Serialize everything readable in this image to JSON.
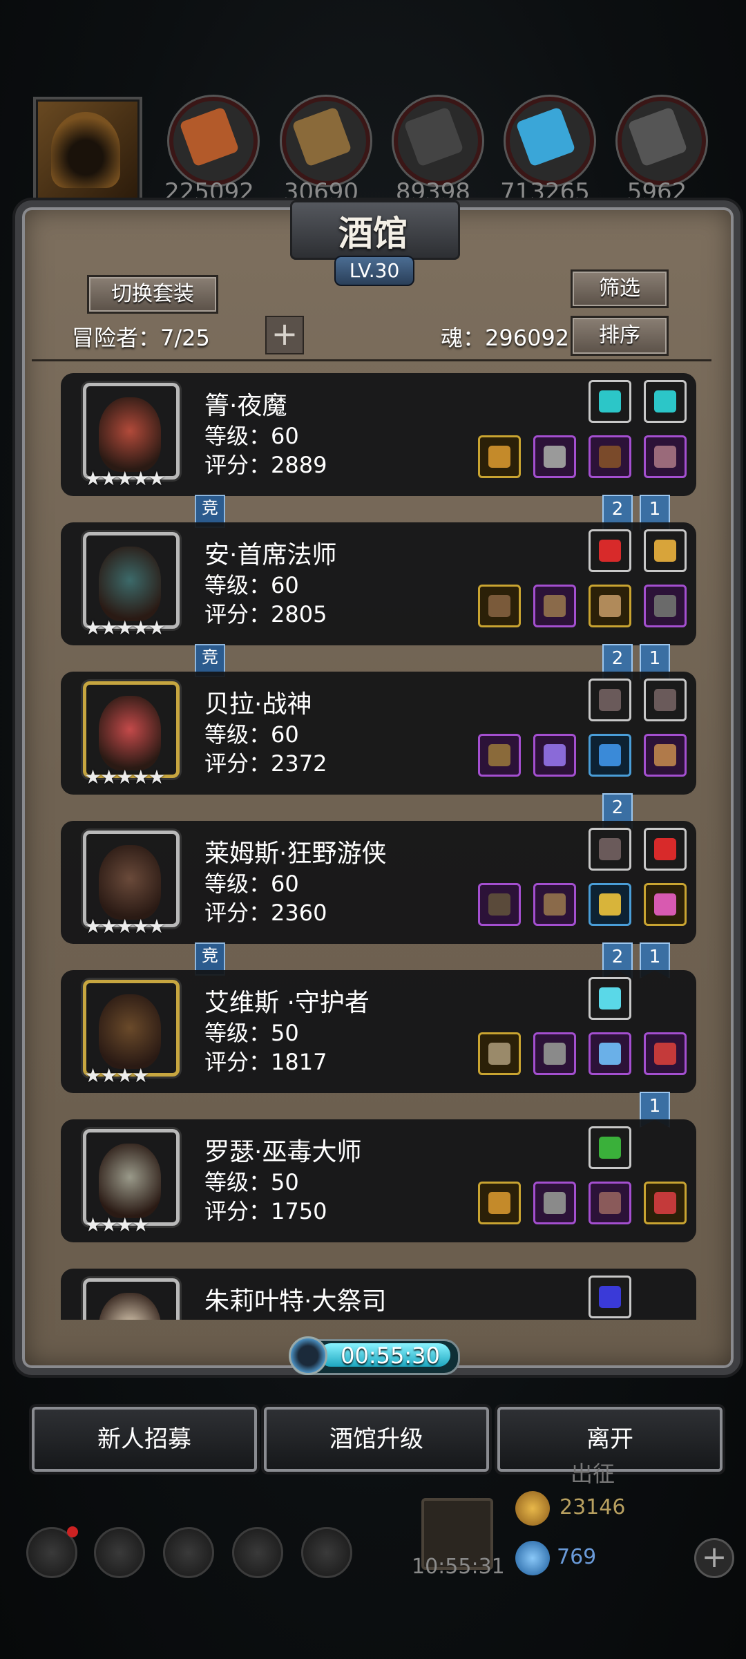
{
  "resources": {
    "values": [
      "225092",
      "30690",
      "89398",
      "713265",
      "5962"
    ],
    "colors": [
      "#b35a2a",
      "#8a6a3a",
      "#444444",
      "#3aa6d8",
      "#555555"
    ]
  },
  "panel": {
    "title": "酒馆",
    "level": "LV.30",
    "switch_set": "切换套装",
    "filter": "筛选",
    "sort": "排序",
    "adventurers": "冒险者：7/25",
    "add": "+",
    "soul": "魂：296092"
  },
  "heroes": [
    {
      "name": "箐·夜魔",
      "level": "等级：60",
      "score": "评分：2889",
      "stars": "★★★★★",
      "frame": "white",
      "face": "#b24a3a",
      "top": [
        "#2cc6c8",
        "#2cc6c8"
      ],
      "topc": [
        "w",
        "w"
      ],
      "bottom": [
        "#c48a2a",
        "#9a9a9a",
        "#7a4a2a",
        "#9a6a7a"
      ],
      "botc": [
        "y",
        "p",
        "p",
        "p"
      ],
      "ribbons": [
        "2",
        "1"
      ],
      "jing": "竞"
    },
    {
      "name": "安·首席法师",
      "level": "等级：60",
      "score": "评分：2805",
      "stars": "★★★★★",
      "frame": "white",
      "face": "#3c6a6a",
      "top": [
        "#d82a2a",
        "#d8a43a"
      ],
      "topc": [
        "w",
        "w"
      ],
      "bottom": [
        "#7a5a3a",
        "#8a6a4a",
        "#b08a5a",
        "#6a6a6a"
      ],
      "botc": [
        "y",
        "p",
        "y",
        "p"
      ],
      "ribbons": [
        "2",
        "1"
      ],
      "jing": "竞"
    },
    {
      "name": "贝拉·战神",
      "level": "等级：60",
      "score": "评分：2372",
      "stars": "★★★★★",
      "frame": "gold",
      "face": "#c44a4a",
      "top": [
        "#6a5a5a",
        "#6a5a5a"
      ],
      "topc": [
        "w",
        "w"
      ],
      "bottom": [
        "#8a6a3a",
        "#8a6ad8",
        "#3a8ad8",
        "#b07a4a"
      ],
      "botc": [
        "p",
        "p",
        "b",
        "p"
      ],
      "ribbons": [
        "2"
      ],
      "jing": ""
    },
    {
      "name": "莱姆斯·狂野游侠",
      "level": "等级：60",
      "score": "评分：2360",
      "stars": "★★★★★",
      "frame": "white",
      "face": "#6a4a3a",
      "top": [
        "#6a5a5a",
        "#d82a2a"
      ],
      "topc": [
        "w",
        "w"
      ],
      "bottom": [
        "#5a4a3a",
        "#8a6a4a",
        "#d8b43a",
        "#d85ab0"
      ],
      "botc": [
        "p",
        "p",
        "b",
        "y"
      ],
      "ribbons": [
        "2",
        "1"
      ],
      "jing": "竞"
    },
    {
      "name": "艾维斯 ·守护者",
      "level": "等级：50",
      "score": "评分：1817",
      "stars": "★★★★",
      "frame": "gold",
      "face": "#6a4a2a",
      "top": [
        "#5ad8e8"
      ],
      "topc": [
        "w"
      ],
      "bottom": [
        "#9a8a6a",
        "#8a8a8a",
        "#6ab0e8",
        "#c43a3a"
      ],
      "botc": [
        "y",
        "p",
        "p",
        "p"
      ],
      "ribbons": [
        "1"
      ],
      "jing": ""
    },
    {
      "name": "罗瑟·巫毒大师",
      "level": "等级：50",
      "score": "评分：1750",
      "stars": "★★★★",
      "frame": "white",
      "face": "#9a9a8a",
      "top": [
        "#3ab03a"
      ],
      "topc": [
        "w"
      ],
      "bottom": [
        "#c48a2a",
        "#8a8a8a",
        "#8a5a5a",
        "#c43a3a"
      ],
      "botc": [
        "y",
        "p",
        "p",
        "y"
      ],
      "ribbons": [],
      "jing": ""
    },
    {
      "name": "朱莉叶特·大祭司",
      "level": "",
      "score": "",
      "stars": "",
      "frame": "white",
      "face": "#d8c8b0",
      "top": [
        "#3a3ad8"
      ],
      "topc": [
        "w"
      ],
      "bottom": [],
      "botc": [],
      "ribbons": [],
      "jing": ""
    }
  ],
  "timer": "00:55:30",
  "buttons": {
    "recruit": "新人招募",
    "upgrade": "酒馆升级",
    "leave": "离开"
  },
  "bottom": {
    "clock": "10:55:31",
    "gold": "23146",
    "gems": "769",
    "faded_text": "出征"
  }
}
